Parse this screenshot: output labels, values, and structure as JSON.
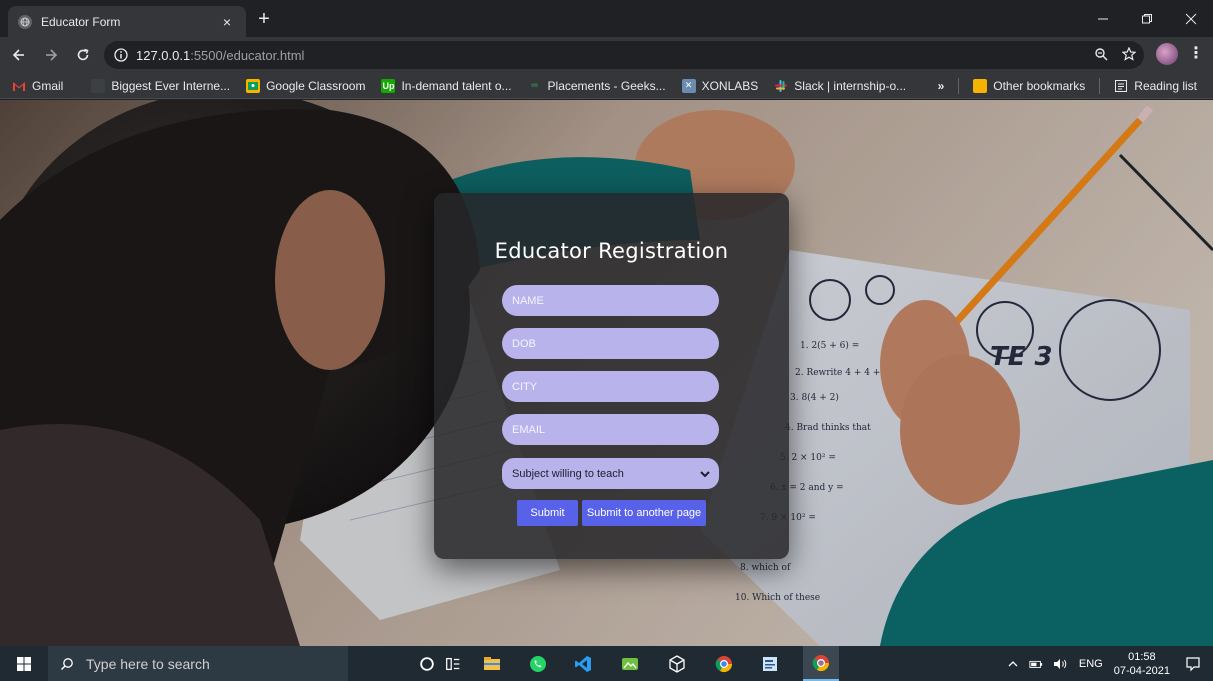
{
  "browser": {
    "tab_title": "Educator Form",
    "tab_close": "×",
    "new_tab": "+",
    "url_host": "127.0.0.1",
    "url_path": ":5500/educator.html"
  },
  "bookmarks": {
    "items": [
      {
        "label": "Gmail",
        "icon": "gmail-icon",
        "color": "#ea4335"
      },
      {
        "label": "Biggest Ever Interne...",
        "icon": "page-icon",
        "color": "#3c4043"
      },
      {
        "label": "Google Classroom",
        "icon": "classroom-icon",
        "color": "#f4b400"
      },
      {
        "label": "In-demand talent o...",
        "icon": "upwork-icon",
        "color": "#14a800"
      },
      {
        "label": "Placements - Geeks...",
        "icon": "geeks-icon",
        "color": "#2f8d46"
      },
      {
        "label": "XONLABS",
        "icon": "xonlabs-icon",
        "color": "#6a8caf"
      },
      {
        "label": "Slack | internship-o...",
        "icon": "slack-icon",
        "color": "#4a154b"
      }
    ],
    "overflow": "»",
    "other": "Other bookmarks",
    "reading_list": "Reading list"
  },
  "form": {
    "title": "Educator Registration",
    "name_placeholder": "NAME",
    "dob_placeholder": "DOB",
    "city_placeholder": "CITY",
    "email_placeholder": "EMAIL",
    "subject_selected": "Subject willing to teach",
    "submit_label": "Submit",
    "submit_other_label": "Submit to another page"
  },
  "taskbar": {
    "search_placeholder": "Type here to search",
    "language": "ENG",
    "time": "01:58",
    "date": "07-04-2021"
  },
  "colors": {
    "accent_button": "#5862e8",
    "field_bg": "#b9b3ec",
    "card_bg": "#26262a"
  }
}
